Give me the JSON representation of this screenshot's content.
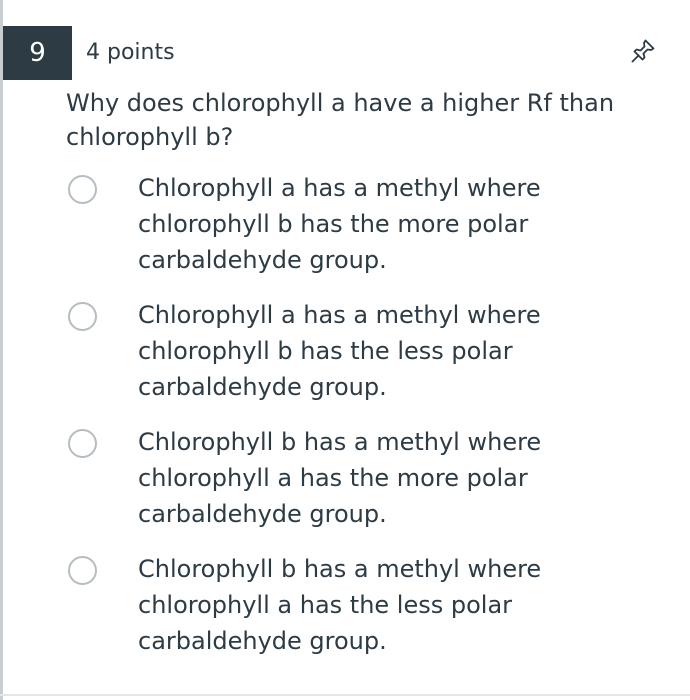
{
  "question": {
    "number": "9",
    "points": "4 points",
    "text": "Why does chlorophyll a have a higher Rf than chlorophyll b?",
    "pin_icon": "pin-icon"
  },
  "answers": [
    {
      "label": "Chlorophyll a has a methyl where chlorophyll b has the more polar carbaldehyde group.",
      "selected": false
    },
    {
      "label": "Chlorophyll a has a methyl where chlorophyll b has the less polar carbaldehyde group.",
      "selected": false
    },
    {
      "label": "Chlorophyll b has a methyl where chlorophyll a has the more polar carbaldehyde group.",
      "selected": false
    },
    {
      "label": "Chlorophyll b has a methyl where chlorophyll a has the less polar carbaldehyde group.",
      "selected": false
    }
  ],
  "colors": {
    "header_badge": "#2d3b45",
    "text": "#2d3b45",
    "radio_border": "#b5bdc3"
  }
}
